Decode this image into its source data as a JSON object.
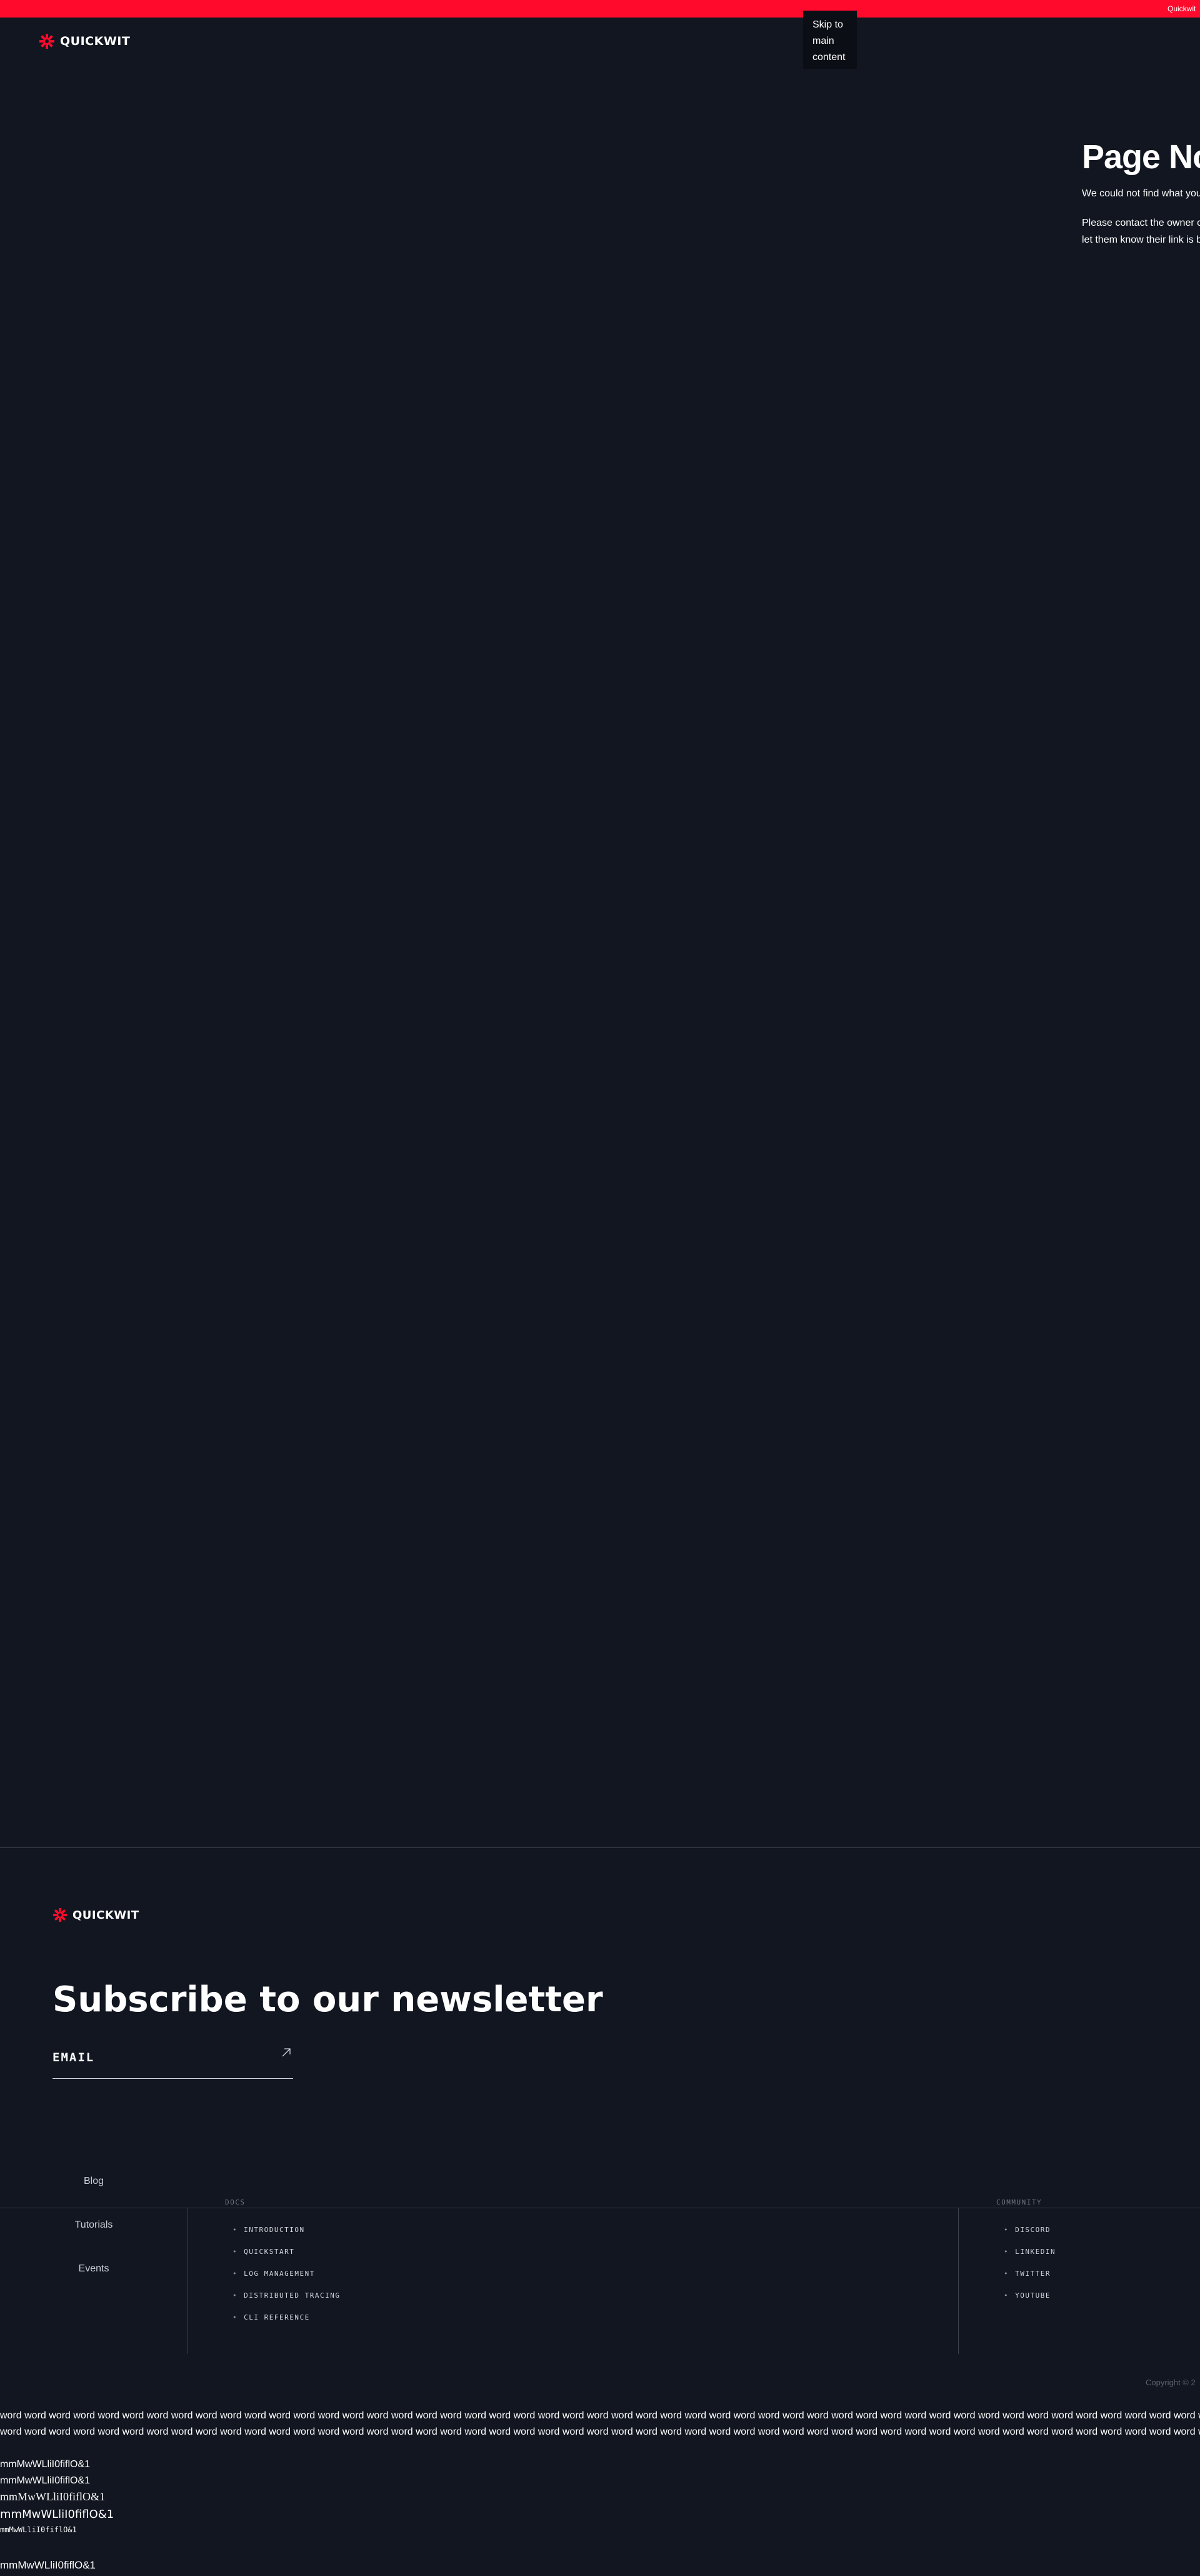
{
  "banner": {
    "text": "Quickwit",
    "color": "#ff0a2c"
  },
  "skip_link": "Skip to main content",
  "header": {
    "logo_text": "QUICKWIT"
  },
  "not_found": {
    "title": "Page Not",
    "paragraph1": "We could not find what you",
    "paragraph2_line1": "Please contact the owner o",
    "paragraph2_line2": "let them know their link is b"
  },
  "footer": {
    "logo_text": "QUICKWIT",
    "newsletter_title": "Subscribe to our newsletter",
    "email_placeholder": "EMAIL",
    "side_links": [
      "Blog",
      "Tutorials",
      "Events"
    ],
    "docs": {
      "heading": "DOCS",
      "links": [
        "INTRODUCTION",
        "QUICKSTART",
        "LOG MANAGEMENT",
        "DISTRIBUTED TRACING",
        "CLI REFERENCE"
      ]
    },
    "community": {
      "heading": "COMMUNITY",
      "links": [
        "DISCORD",
        "LINKEDIN",
        "TWITTER",
        "YOUTUBE"
      ]
    },
    "copyright": "Copyright © 2"
  },
  "font_test": {
    "word_line": "word word word word word word word word word word word word word word word word word word word word word word word word word word word word word word word word word word word word word word word word word word word word word word word word word word word word word word word word word word word word word word word word word word word word word word word word word word word word word word word word word word word",
    "line1": "mmMwWLliI0fiflO&1",
    "line2": "mmMwWLliI0fiflO&1",
    "line3": "mmMwWLliI0fiflO&1",
    "line4": "mmMwWLliI0fiflO&1",
    "line5": "mmMwWLliI0fiflO&1",
    "line6": "mmMwWLliI0fiflO&1"
  },
  "colors": {
    "background": "#111620",
    "brand_red": "#ff0a2c",
    "divider": "#3a404c"
  },
  "icons": {
    "logo": "quickwit-logo-icon",
    "submit": "arrow-up-right-icon"
  }
}
